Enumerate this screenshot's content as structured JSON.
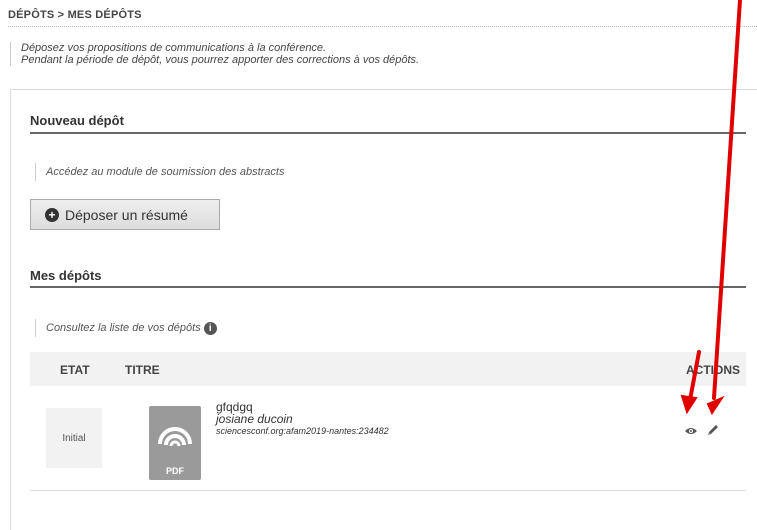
{
  "breadcrumb": "DÉPÔTS > MES DÉPÔTS",
  "intro": {
    "line1": "Déposez vos propositions de communications à la conférence.",
    "line2": "Pendant la période de dépôt, vous pourrez apporter des corrections à vos dépôts."
  },
  "new_deposit": {
    "title": "Nouveau dépôt",
    "note": "Accédez au module de soumission des abstracts",
    "button_label": "Déposer un résumé"
  },
  "my_deposits": {
    "title": "Mes dépôts",
    "note": "Consultez la liste de vos dépôts",
    "info_icon": "info-icon",
    "columns": {
      "state": "ETAT",
      "title": "TITRE",
      "actions": "ACTIONS"
    },
    "rows": [
      {
        "state": "Initial",
        "file_type": "PDF",
        "title": "gfqdgq",
        "author": "josiane ducoin",
        "docid": "sciencesconf.org:afam2019-nantes:234482",
        "actions": [
          "eye-icon",
          "pencil-icon"
        ]
      }
    ]
  },
  "annotation_color": "#e00000"
}
